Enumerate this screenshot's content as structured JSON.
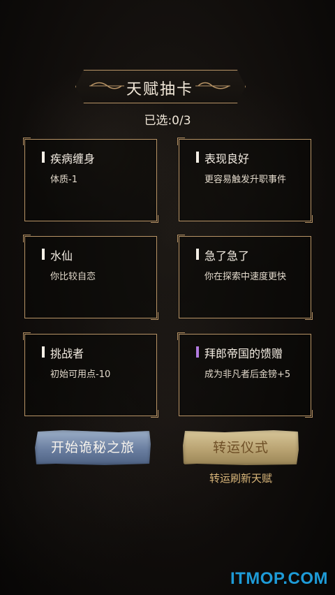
{
  "title": "天赋抽卡",
  "selected_text": "已选:0/3",
  "cards": [
    {
      "title": "疾病缠身",
      "desc": "体质-1",
      "accent": "#f4efe6"
    },
    {
      "title": "表现良好",
      "desc": "更容易触发升职事件",
      "accent": "#f4efe6"
    },
    {
      "title": "水仙",
      "desc": "你比较自恋",
      "accent": "#f4efe6"
    },
    {
      "title": "急了急了",
      "desc": "你在探索中速度更快",
      "accent": "#f4efe6"
    },
    {
      "title": "挑战者",
      "desc": "初始可用点-10",
      "accent": "#f4efe6"
    },
    {
      "title": "拜郎帝国的馈赠",
      "desc": "成为非凡者后金镑+5",
      "accent": "#b27be0"
    }
  ],
  "buttons": {
    "start": "开始诡秘之旅",
    "reroll": "转运仪式",
    "reroll_hint": "转运刷新天赋"
  },
  "watermark": "ITMOP.COM",
  "colors": {
    "frame": "#b89466",
    "purple_accent": "#b27be0",
    "watermark": "#1e9bd7"
  }
}
